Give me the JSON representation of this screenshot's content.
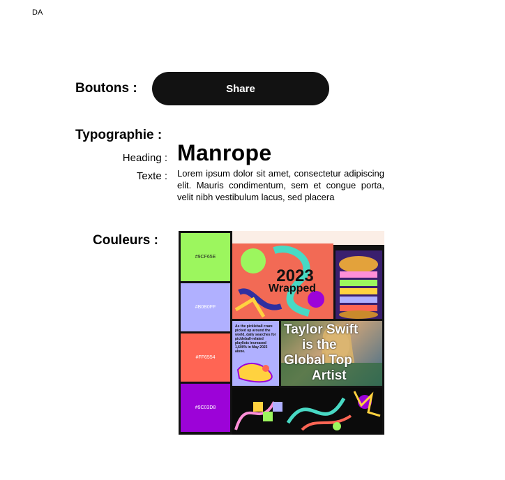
{
  "corner": "DA",
  "sections": {
    "buttons": "Boutons :",
    "typography": "Typographie :",
    "colors": "Couleurs :"
  },
  "button": {
    "label": "Share",
    "bg": "#121212",
    "color": "#ffffff"
  },
  "typography": {
    "heading_label": "Heading :",
    "heading_font": "Manrope",
    "text_label": "Texte :",
    "text_sample": "Lorem ipsum dolor sit amet, consectetur adipiscing elit. Mauris condimentum, sem et congue porta, velit nibh vestibulum lacus, sed placera"
  },
  "palette": [
    {
      "hex": "#9CF65E",
      "label": "#9CF65E"
    },
    {
      "hex": "#B0B0FF",
      "label": "#B0B0FF"
    },
    {
      "hex": "#FF6554",
      "label": "#FF6554"
    },
    {
      "hex": "#9C03D8",
      "label": "#9C03D8"
    }
  ],
  "moodboard": {
    "wrapped_year": "2023",
    "wrapped_word": "Wrapped",
    "pickleball_text": "As the pickleball craze picked up around the world, daily searches for pickleball-related playlists increased 1,600% in May 2023 alone.",
    "taylor_lines": [
      "Taylor Swift",
      "is the",
      "Global Top",
      "Artist"
    ]
  }
}
